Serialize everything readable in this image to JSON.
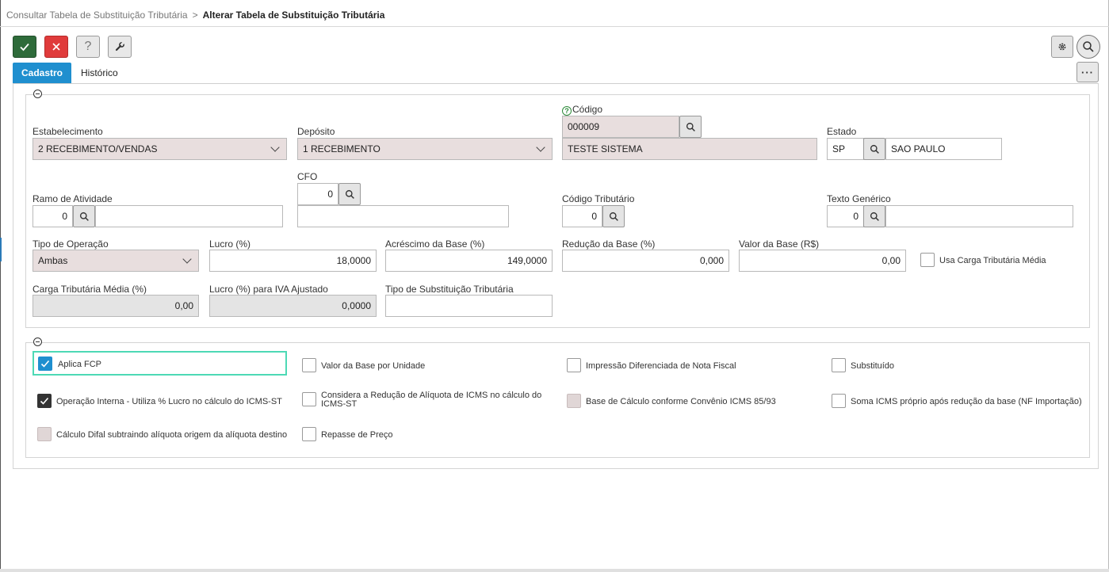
{
  "breadcrumb": {
    "parent": "Consultar Tabela de Substituição Tributária",
    "separator": ">",
    "current": "Alterar Tabela de Substituição Tributária"
  },
  "toolbar": {
    "confirm_icon": "check-icon",
    "cancel_icon": "close-icon",
    "help_icon": "help-icon",
    "tools_icon": "wrench-icon",
    "settings_icon": "gear-icon",
    "search_icon": "search-icon",
    "more_icon": "more-icon",
    "help_glyph": "?",
    "more_glyph": "···"
  },
  "tabs": [
    {
      "label": "Cadastro",
      "active": true
    },
    {
      "label": "Histórico",
      "active": false
    }
  ],
  "form": {
    "estabelecimento": {
      "label": "Estabelecimento",
      "value": "2 RECEBIMENTO/VENDAS"
    },
    "deposito": {
      "label": "Depósito",
      "value": "1 RECEBIMENTO"
    },
    "codigo": {
      "label": "Código",
      "value": "000009",
      "description": "TESTE SISTEMA"
    },
    "estado": {
      "label": "Estado",
      "code": "SP",
      "name": "SAO PAULO"
    },
    "ramo_atividade": {
      "label": "Ramo de Atividade",
      "value": "0",
      "description": ""
    },
    "cfo": {
      "label": "CFO",
      "value": "0",
      "description": ""
    },
    "codigo_tributario": {
      "label": "Código Tributário",
      "value": "0"
    },
    "texto_generico": {
      "label": "Texto Genérico",
      "value": "0",
      "description": ""
    },
    "tipo_operacao": {
      "label": "Tipo de Operação",
      "value": "Ambas"
    },
    "lucro": {
      "label": "Lucro (%)",
      "value": "18,0000"
    },
    "acrescimo_base": {
      "label": "Acréscimo da Base (%)",
      "value": "149,0000"
    },
    "reducao_base": {
      "label": "Redução da Base (%)",
      "value": "0,000"
    },
    "valor_base": {
      "label": "Valor da Base (R$)",
      "value": "0,00"
    },
    "usa_carga": {
      "label": "Usa Carga Tributária Média",
      "checked": false
    },
    "carga_media": {
      "label": "Carga Tributária Média (%)",
      "value": "0,00"
    },
    "lucro_iva": {
      "label": "Lucro (%) para IVA Ajustado",
      "value": "0,0000"
    },
    "tipo_substituicao": {
      "label": "Tipo de Substituição Tributária",
      "value": ""
    }
  },
  "options": {
    "aplica_fcp": {
      "label": "Aplica FCP",
      "checked": true
    },
    "valor_base_unidade": {
      "label": "Valor da Base por Unidade",
      "checked": false
    },
    "impressao_diferenciada": {
      "label": "Impressão Diferenciada de Nota Fiscal",
      "checked": false
    },
    "substituido": {
      "label": "Substituído",
      "checked": false
    },
    "operacao_interna": {
      "label": "Operação Interna - Utiliza % Lucro no cálculo do ICMS-ST",
      "checked": true
    },
    "considera_reducao": {
      "label_line1": "Considera a Redução de Alíquota de ICMS no cálculo do",
      "label_line2": "ICMS-ST",
      "checked": false
    },
    "base_convenio": {
      "label": "Base de Cálculo conforme Convênio ICMS 85/93",
      "checked": false,
      "disabled": true
    },
    "soma_icms": {
      "label": "Soma ICMS próprio após redução da base (NF Importação)",
      "checked": false
    },
    "calculo_difal": {
      "label": "Cálculo Difal subtraindo alíquota origem da alíquota destino",
      "checked": false,
      "disabled": true
    },
    "repasse_preco": {
      "label": "Repasse de Preço",
      "checked": false
    }
  },
  "colors": {
    "accent": "#1f8fcf",
    "confirm": "#2e6b3a",
    "cancel": "#e03b3b",
    "readonly_field": "#e8dede",
    "focus": "#4dd9b5"
  }
}
